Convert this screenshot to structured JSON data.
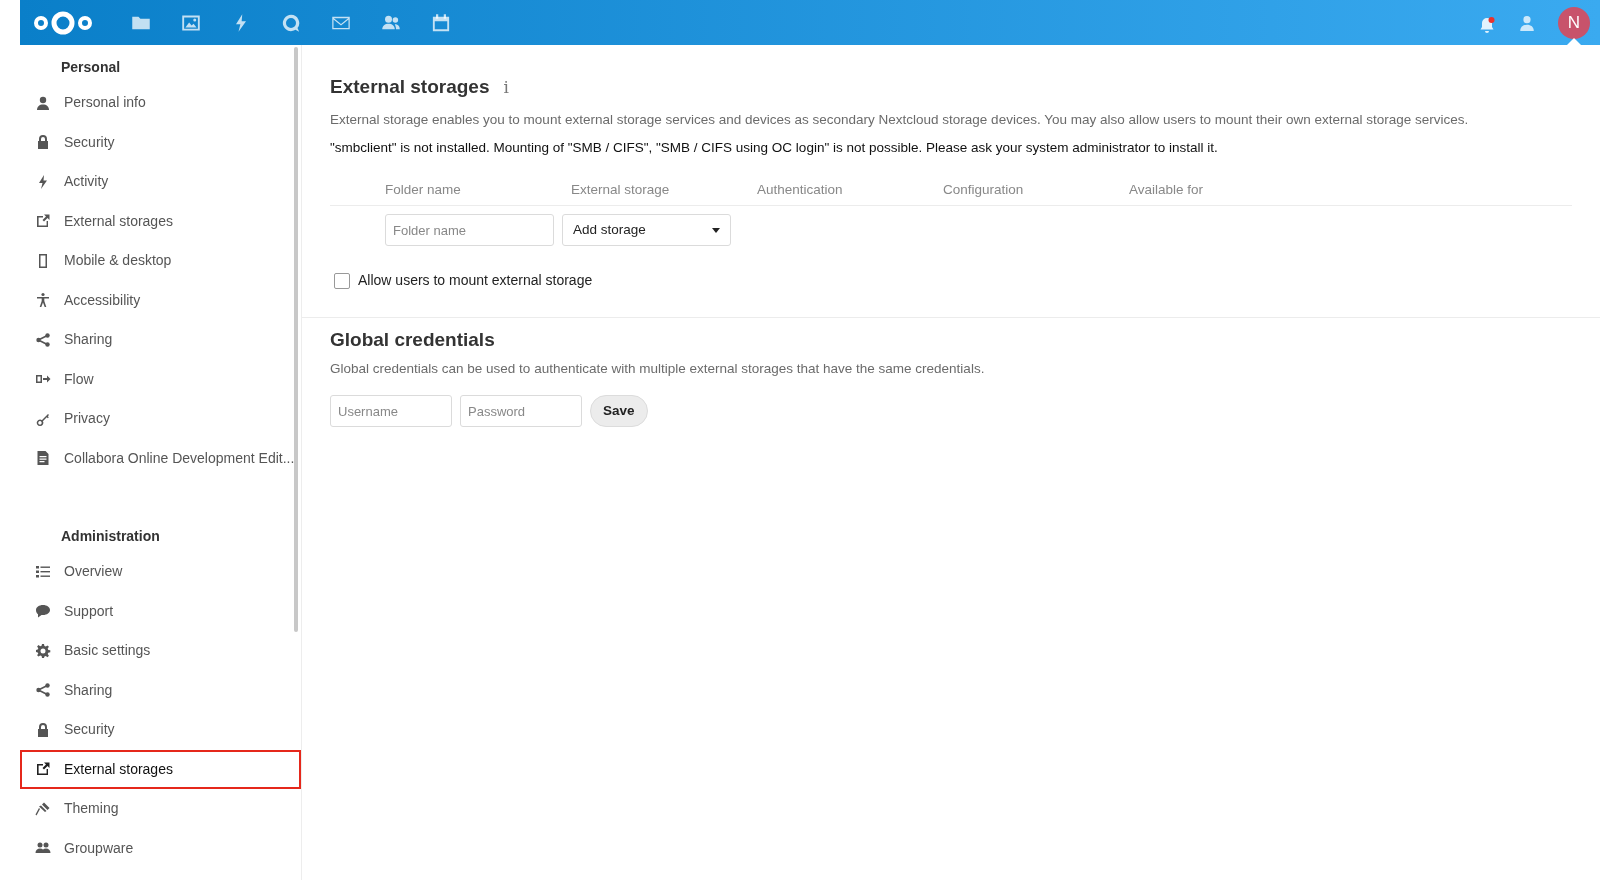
{
  "header": {
    "apps": [
      {
        "kind": "folder"
      },
      {
        "kind": "image"
      },
      {
        "kind": "bolt"
      },
      {
        "kind": "chat"
      },
      {
        "kind": "mail"
      },
      {
        "kind": "contacts"
      },
      {
        "kind": "calendar"
      }
    ],
    "notifications": {
      "unread": true
    },
    "avatar": {
      "initial": "N",
      "color": "#c8536b"
    }
  },
  "sidebar": {
    "sections": [
      {
        "title": "Personal",
        "items": [
          {
            "label": "Personal info",
            "kind": "user",
            "selected": false
          },
          {
            "label": "Security",
            "kind": "lock",
            "selected": false
          },
          {
            "label": "Activity",
            "kind": "bolt",
            "selected": false
          },
          {
            "label": "External storages",
            "kind": "external",
            "selected": false
          },
          {
            "label": "Mobile & desktop",
            "kind": "phone",
            "selected": false
          },
          {
            "label": "Accessibility",
            "kind": "accessibility",
            "selected": false
          },
          {
            "label": "Sharing",
            "kind": "share",
            "selected": false
          },
          {
            "label": "Flow",
            "kind": "flow",
            "selected": false
          },
          {
            "label": "Privacy",
            "kind": "key",
            "selected": false
          },
          {
            "label": "Collabora Online Development Edit...",
            "kind": "document",
            "selected": false
          }
        ]
      },
      {
        "title": "Administration",
        "items": [
          {
            "label": "Overview",
            "kind": "list",
            "selected": false
          },
          {
            "label": "Support",
            "kind": "bubble",
            "selected": false
          },
          {
            "label": "Basic settings",
            "kind": "gear",
            "selected": false
          },
          {
            "label": "Sharing",
            "kind": "share",
            "selected": false
          },
          {
            "label": "Security",
            "kind": "lock",
            "selected": false
          },
          {
            "label": "External storages",
            "kind": "external",
            "selected": true
          },
          {
            "label": "Theming",
            "kind": "brush",
            "selected": false
          },
          {
            "label": "Groupware",
            "kind": "group",
            "selected": false
          }
        ]
      }
    ]
  },
  "external_storages": {
    "title": "External storages",
    "info_icon": "i",
    "description": "External storage enables you to mount external storage services and devices as secondary Nextcloud storage devices. You may also allow users to mount their own external storage services.",
    "warning": "\"smbclient\" is not installed. Mounting of \"SMB / CIFS\", \"SMB / CIFS using OC login\" is not possible. Please ask your system administrator to install it.",
    "table": {
      "columns": [
        "Folder name",
        "External storage",
        "Authentication",
        "Configuration",
        "Available for"
      ],
      "new_row": {
        "folder_placeholder": "Folder name",
        "storage_select": "Add storage"
      }
    },
    "allow_users": {
      "label": "Allow users to mount external storage",
      "checked": false
    }
  },
  "global_credentials": {
    "title": "Global credentials",
    "description": "Global credentials can be used to authenticate with multiple external storages that have the same credentials.",
    "username_placeholder": "Username",
    "password_placeholder": "Password",
    "save_button": "Save"
  }
}
